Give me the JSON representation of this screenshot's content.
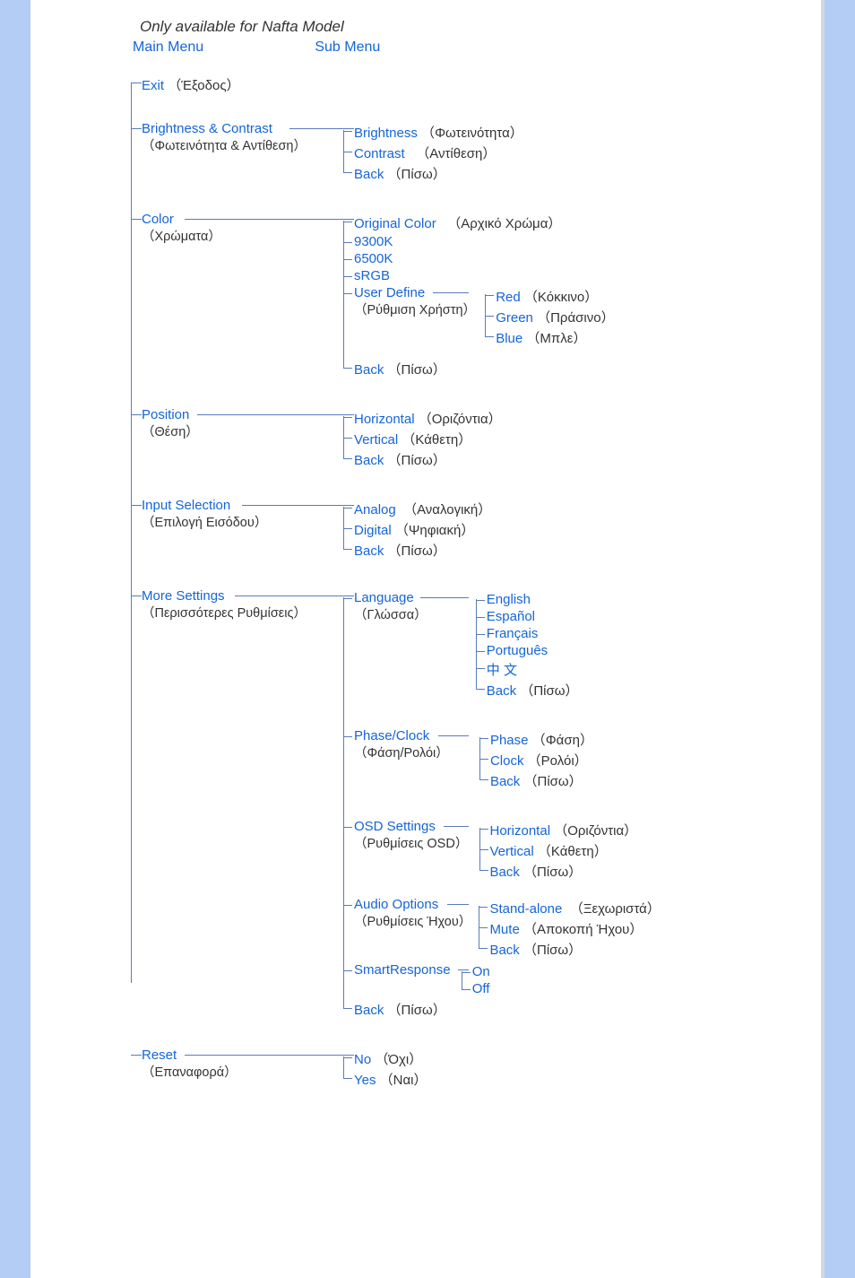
{
  "note": "Only available for Nafta Model",
  "headers": {
    "main": "Main Menu",
    "sub": "Sub Menu"
  },
  "exit": {
    "en": "Exit",
    "gr": "Έξοδος"
  },
  "bc": {
    "en": "Brightness &  Contrast",
    "gr": "Φωτεινότητα & Αντίθεση",
    "items": [
      {
        "en": "Brightness",
        "gr": "Φωτεινότητα"
      },
      {
        "en": "Contrast",
        "gr": "Αντίθεση"
      },
      {
        "en": "Back",
        "gr": "Πίσω"
      }
    ]
  },
  "color": {
    "en": "Color",
    "gr": "Χρώματα",
    "items": [
      {
        "en": "Original Color",
        "gr": "Αρχικό Χρώμα"
      },
      {
        "en": "9300K"
      },
      {
        "en": "6500K"
      },
      {
        "en": "sRGB"
      },
      {
        "en": "User Define",
        "gr": "Ρύθμιση Χρήστη",
        "children": [
          {
            "en": "Red",
            "gr": "Κόκκινο"
          },
          {
            "en": "Green",
            "gr": "Πράσινο"
          },
          {
            "en": "Blue",
            "gr": "Μπλε"
          }
        ]
      },
      {
        "en": "Back",
        "gr": "Πίσω"
      }
    ]
  },
  "position": {
    "en": "Position",
    "gr": "Θέση",
    "items": [
      {
        "en": "Horizontal",
        "gr": "Οριζόντια"
      },
      {
        "en": "Vertical",
        "gr": "Κάθετη"
      },
      {
        "en": "Back",
        "gr": "Πίσω"
      }
    ]
  },
  "input": {
    "en": "Input Selection",
    "gr": "Επιλογή Εισόδου",
    "items": [
      {
        "en": "Analog",
        "gr": "Αναλογική"
      },
      {
        "en": "Digital",
        "gr": "Ψηφιακή"
      },
      {
        "en": "Back",
        "gr": "Πίσω"
      }
    ]
  },
  "more": {
    "en": "More Settings",
    "gr": "Περισσότερες Ρυθμίσεις",
    "items": [
      {
        "en": "Language",
        "gr": "Γλώσσα",
        "children": [
          {
            "en": "English"
          },
          {
            "en": "Español"
          },
          {
            "en": "Français"
          },
          {
            "en": "Português"
          },
          {
            "en": "中 文"
          },
          {
            "en": "Back",
            "gr": "Πίσω"
          }
        ]
      },
      {
        "en": "Phase/Clock",
        "gr": "Φάση/Ρολόι",
        "children": [
          {
            "en": "Phase",
            "gr": "Φάση"
          },
          {
            "en": "Clock",
            "gr": "Ρολόι"
          },
          {
            "en": "Back",
            "gr": "Πίσω"
          }
        ]
      },
      {
        "en": "OSD Settings",
        "gr": "Ρυθμίσεις OSD",
        "children": [
          {
            "en": "Horizontal",
            "gr": "Οριζόντια"
          },
          {
            "en": "Vertical",
            "gr": "Κάθετη"
          },
          {
            "en": "Back",
            "gr": "Πίσω"
          }
        ]
      },
      {
        "en": "Audio Options",
        "gr": "Ρυθμίσεις Ήχου",
        "children": [
          {
            "en": "Stand-alone",
            "gr": "Ξεχωριστά"
          },
          {
            "en": "Mute",
            "gr": "Αποκοπή Ήχου"
          },
          {
            "en": "Back",
            "gr": "Πίσω"
          }
        ]
      },
      {
        "en": "SmartResponse",
        "children": [
          {
            "en": "On"
          },
          {
            "en": "Off"
          }
        ]
      },
      {
        "en": "Back",
        "gr": "Πίσω"
      }
    ]
  },
  "reset": {
    "en": "Reset",
    "gr": "Επαναφορά",
    "items": [
      {
        "en": "No",
        "gr": "Όχι"
      },
      {
        "en": "Yes",
        "gr": "Ναι"
      }
    ]
  }
}
